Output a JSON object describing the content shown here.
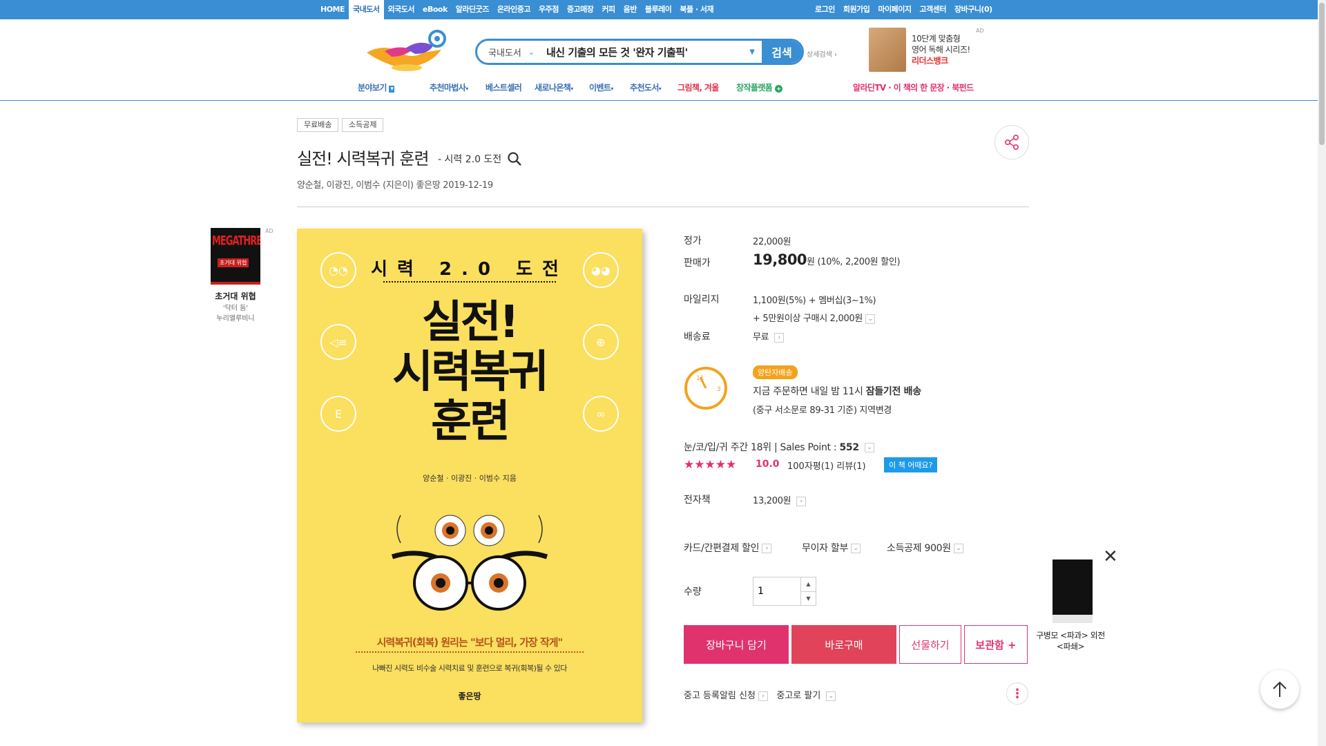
{
  "topnav": {
    "left": [
      "HOME",
      "국내도서",
      "외국도서",
      "eBook",
      "알라딘굿즈",
      "온라인중고",
      "우주점",
      "중고매장",
      "커피",
      "음반",
      "블루레이",
      "북플 · 서재"
    ],
    "active_index": 1,
    "right": [
      "로그인",
      "회원가입",
      "마이페이지",
      "고객센터",
      "장바구니(0)"
    ]
  },
  "search": {
    "category": "국내도서",
    "query": "내신 기출의 모든 것 '완자 기출픽'",
    "button": "검색",
    "advanced": "상세검색"
  },
  "header_ad": {
    "line1": "10단계 맞춤형",
    "line2": "영어 독해 시리즈!",
    "brand": "리더스뱅크",
    "tag": "AD"
  },
  "menu": {
    "category": "분야보기",
    "items": [
      "추천마법사",
      "베스트셀러",
      "새로나온책",
      "이벤트",
      "추천도서"
    ],
    "special": "그림책, 겨울",
    "creator": "창작플랫폼",
    "right": "알라딘TV · 이 책의 한 문장 · 북펀드"
  },
  "product": {
    "tags": [
      "무료배송",
      "소득공제"
    ],
    "title": "실전! 시력복귀 훈련",
    "subtitle": "- 시력 2.0 도전",
    "authors": "양순철,   이광진,   이범수 (지은이)   좋은땅   2019-12-19"
  },
  "left_ad": {
    "cover_text": "MEGATHREATS",
    "cover_sub": "초거대 위협",
    "title": "초거대 위협",
    "author": "'닥터 둠'",
    "author2": "누리엘루비니",
    "tag": "AD"
  },
  "cover": {
    "top": "시력 2.0 도전",
    "title1": "실전!",
    "title2": "시력복귀",
    "title3": "훈련",
    "authors": "양순철 · 이광진 · 이범수 지음",
    "slogan": "시력복귀(회복) 원리는 \"보다 멀리, 가장 작게\"",
    "desc": "나빠진 시력도 비수술 시력치료 및 훈련으로 복귀(회복)될 수 있다",
    "publisher": "좋은땅"
  },
  "price": {
    "list_label": "정가",
    "list_value": "22,000원",
    "sale_label": "판매가",
    "sale_value": "19,800",
    "sale_suffix": "원 (10%, 2,200원 할인)",
    "mileage_label": "마일리지",
    "mileage_line1": "1,100원(5%) + 멤버십(3~1%)",
    "mileage_line2": "+ 5만원이상 구매시 2,000원",
    "shipping_label": "배송료",
    "shipping_value": "무료"
  },
  "delivery": {
    "badge": "양탄자배송",
    "line1_pre": "지금 주문하면 내일 밤 11시 ",
    "line1_bold": "잠들기전 배송",
    "line2": "(중구 서소문로 89-31 기준) 지역변경",
    "clock_11": "11",
    "clock_3": "3"
  },
  "rank": {
    "text": "눈/코/입/귀 주간 18위  |  Sales Point : ",
    "sales_point": "552",
    "stars": "★★★★★",
    "rating": "10.0",
    "reviews": "100자평(1)   리뷰(1)",
    "how_button": "이 책 어때요?"
  },
  "ebook": {
    "label": "전자책",
    "value": "13,200원"
  },
  "options": {
    "card": "카드/간편결제 할인",
    "installment": "무이자 할부",
    "deduction": "소득공제 900원"
  },
  "quantity": {
    "label": "수량",
    "value": "1"
  },
  "buttons": {
    "cart": "장바구니 담기",
    "buy": "바로구매",
    "gift": "선물하기",
    "keep": "보관함 +"
  },
  "used": {
    "alert": "중고 등록알림 신청",
    "sell": "중고로 팔기"
  },
  "right_ad": {
    "line1": "구병모 <파과> 외전",
    "line2": "<파쇄>"
  },
  "colors": {
    "primary_blue": "#3a8ed3",
    "accent_pink": "#e0336e",
    "buy_red": "#e0435a",
    "cover_yellow": "#fbdf5e"
  }
}
